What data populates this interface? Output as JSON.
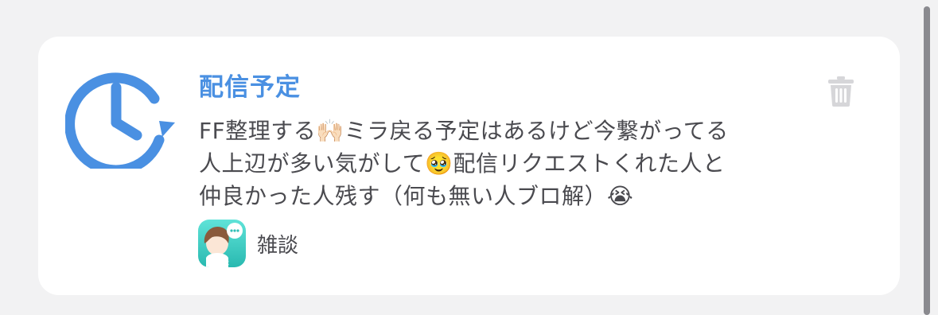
{
  "notification": {
    "title": "配信予定",
    "lines": [
      {
        "before": "FF整理する",
        "emoji": "🙌🏻",
        "after": "ミラ戻る予定はあるけど今繋がってる"
      },
      {
        "before": "人上辺が多い気がして",
        "emoji": "🥹",
        "after": "配信リクエストくれた人と"
      },
      {
        "before": "仲良かった人残す（何も無い人ブロ解）",
        "emoji": "😭",
        "after": ""
      }
    ],
    "category": {
      "name": "雑談",
      "thumb_badge": "雑談"
    }
  },
  "colors": {
    "accent": "#4a90e2",
    "text": "#4a4a4f",
    "trash": "#d6d6d9",
    "thumb": "#2fc0b6"
  },
  "icons": {
    "schedule": "clock-with-circular-arrow-icon",
    "delete": "trash-icon"
  }
}
